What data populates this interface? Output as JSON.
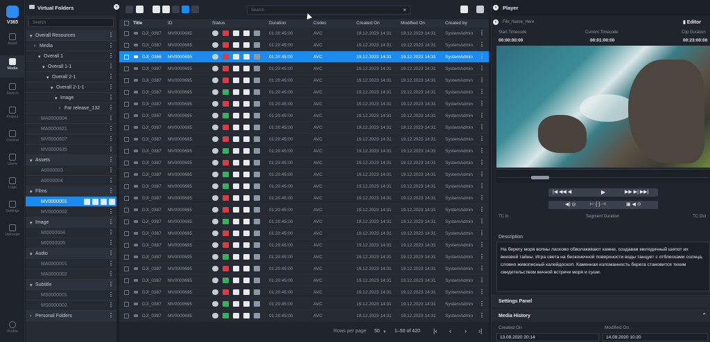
{
  "nav": {
    "brand": "V365",
    "items": [
      {
        "label": "Asset",
        "icon": "asset-icon"
      },
      {
        "label": "Media",
        "icon": "media-icon"
      },
      {
        "label": "Search",
        "icon": "search-icon"
      },
      {
        "label": "Project",
        "icon": "project-icon"
      },
      {
        "label": "Control",
        "icon": "control-icon"
      },
      {
        "label": "Users",
        "icon": "users-icon"
      },
      {
        "label": "Logs",
        "icon": "logs-icon"
      },
      {
        "label": "Settings",
        "icon": "gear-icon"
      },
      {
        "label": "Uploader",
        "icon": "upload-icon"
      },
      {
        "label": "Profile",
        "icon": "profile-icon"
      }
    ]
  },
  "folders": {
    "title": "Virtual Folders",
    "search_placeholder": "Search",
    "tree": [
      {
        "label": "Overall Resources",
        "type": "sec"
      },
      {
        "label": "Media",
        "type": "node"
      },
      {
        "label": "Overall 1",
        "type": "node"
      },
      {
        "label": "Overall 1-1",
        "type": "node"
      },
      {
        "label": "Overall 2-1",
        "type": "node"
      },
      {
        "label": "Overall 2-1-1",
        "type": "node"
      },
      {
        "label": "Image",
        "type": "node"
      },
      {
        "label": "For release_132",
        "type": "node"
      },
      {
        "label": "MA0000604",
        "type": "dim"
      },
      {
        "label": "MA0000621",
        "type": "dim"
      },
      {
        "label": "MV0000607",
        "type": "dim"
      },
      {
        "label": "MV0000635",
        "type": "dim"
      },
      {
        "label": "Assets",
        "type": "sec"
      },
      {
        "label": "A0000003",
        "type": "dim"
      },
      {
        "label": "A0000004",
        "type": "dim"
      },
      {
        "label": "Films",
        "type": "sec"
      },
      {
        "label": "MV0000001",
        "type": "sel"
      },
      {
        "label": "MV0000002",
        "type": "dim"
      },
      {
        "label": "Image",
        "type": "sec"
      },
      {
        "label": "MI0000004",
        "type": "dim"
      },
      {
        "label": "MI0000005",
        "type": "dim"
      },
      {
        "label": "Audio",
        "type": "sec"
      },
      {
        "label": "MA0000001",
        "type": "dim"
      },
      {
        "label": "MA0000002",
        "type": "dim"
      },
      {
        "label": "Subtitle",
        "type": "sec"
      },
      {
        "label": "MS0000001",
        "type": "dim"
      },
      {
        "label": "MS0000002",
        "type": "dim"
      },
      {
        "label": "Personal Folders",
        "type": "sec"
      }
    ]
  },
  "list": {
    "search_placeholder": "Search",
    "columns": [
      "Title",
      "ID",
      "Status",
      "Duration",
      "Codec",
      "Created On",
      "Modified On",
      "Created by"
    ],
    "rows": [
      {
        "title": "DJI_0387",
        "id": "MV0000695",
        "duration": "01:20:45:00",
        "codec": "AVC",
        "created": "19.12.2023 14:31",
        "modified": "19.12.2023 14:31",
        "by": "SystemAdmin",
        "status": "r"
      },
      {
        "title": "DJI_0387",
        "id": "MV0000695",
        "duration": "01:20:45:00",
        "codec": "AVC",
        "created": "19.12.2023 14:31",
        "modified": "19.12.2023 14:31",
        "by": "SystemAdmin",
        "status": "r"
      },
      {
        "title": "DJI_0386",
        "id": "MV0000695",
        "duration": "01:20:45:00",
        "codec": "AVC",
        "created": "19.12.2023 14:31",
        "modified": "19.12.2023 14:31",
        "by": "SystemAdmin",
        "status": "r",
        "selected": true
      },
      {
        "title": "DJI_0387",
        "id": "MV0000695",
        "duration": "01:20:45:00",
        "codec": "AVC",
        "created": "19.12.2023 14:31",
        "modified": "19.12.2023 14:31",
        "by": "SystemAdmin",
        "status": "r"
      },
      {
        "title": "DJI_0387",
        "id": "MV0000695",
        "duration": "01:20:45:00",
        "codec": "AVC",
        "created": "19.12.2023 14:31",
        "modified": "19.12.2023 14:31",
        "by": "SystemAdmin",
        "status": "r"
      },
      {
        "title": "DJI_0387",
        "id": "MV0000695",
        "duration": "01:20:45:00",
        "codec": "AVC",
        "created": "19.12.2023 14:31",
        "modified": "19.12.2023 14:31",
        "by": "SystemAdmin",
        "status": "g"
      },
      {
        "title": "DJI_0387",
        "id": "MV0000695",
        "duration": "01:20:45:00",
        "codec": "AVC",
        "created": "19.12.2023 14:31",
        "modified": "19.12.2023 14:31",
        "by": "SystemAdmin",
        "status": "r"
      },
      {
        "title": "DJI_0387",
        "id": "MV0000695",
        "duration": "01:20:45:00",
        "codec": "AVC",
        "created": "19.12.2023 14:31",
        "modified": "19.12.2023 14:31",
        "by": "SystemAdmin",
        "status": "g"
      },
      {
        "title": "DJI_0387",
        "id": "MV0000695",
        "duration": "01:20:45:00",
        "codec": "AVC",
        "created": "19.12.2023 14:31",
        "modified": "19.12.2023 14:31",
        "by": "SystemAdmin",
        "status": "r"
      },
      {
        "title": "DJI_0387",
        "id": "MV0000695",
        "duration": "01:20:45:00",
        "codec": "AVC",
        "created": "19.12.2023 14:31",
        "modified": "19.12.2023 14:31",
        "by": "SystemAdmin",
        "status": "r"
      },
      {
        "title": "DJI_0387",
        "id": "MV0000695",
        "duration": "01:20:45:00",
        "codec": "AVC",
        "created": "19.12.2023 14:31",
        "modified": "19.12.2023 14:31",
        "by": "SystemAdmin",
        "status": "g"
      },
      {
        "title": "DJI_0387",
        "id": "MV0000695",
        "duration": "01:20:45:00",
        "codec": "AVC",
        "created": "19.12.2023 14:31",
        "modified": "19.12.2023 14:31",
        "by": "SystemAdmin",
        "status": "r"
      },
      {
        "title": "DJI_0387",
        "id": "MV0000695",
        "duration": "01:20:45:00",
        "codec": "AVC",
        "created": "19.12.2023 14:31",
        "modified": "19.12.2023 14:31",
        "by": "SystemAdmin",
        "status": "g"
      },
      {
        "title": "DJI_0387",
        "id": "MV0000695",
        "duration": "01:20:45:00",
        "codec": "AVC",
        "created": "19.12.2023 14:31",
        "modified": "19.12.2023 14:31",
        "by": "SystemAdmin",
        "status": "g"
      },
      {
        "title": "DJI_0387",
        "id": "MV0000695",
        "duration": "01:20:45:00",
        "codec": "AVC",
        "created": "19.12.2023 14:31",
        "modified": "19.12.2023 14:31",
        "by": "SystemAdmin",
        "status": "r"
      },
      {
        "title": "DJI_0387",
        "id": "MV0000695",
        "duration": "01:20:45:00",
        "codec": "AVC",
        "created": "19.12.2023 14:31",
        "modified": "19.12.2023 14:31",
        "by": "SystemAdmin",
        "status": "r"
      },
      {
        "title": "DJI_0387",
        "id": "MV0000695",
        "duration": "01:20:45:00",
        "codec": "AVC",
        "created": "19.12.2023 14:31",
        "modified": "19.12.2023 14:31",
        "by": "SystemAdmin",
        "status": "g"
      },
      {
        "title": "DJI_0387",
        "id": "MV0000695",
        "duration": "01:20:45:00",
        "codec": "AVC",
        "created": "19.12.2023 14:31",
        "modified": "19.12.2023 14:31",
        "by": "SystemAdmin",
        "status": "r"
      },
      {
        "title": "DJI_0387",
        "id": "MV0000695",
        "duration": "01:20:45:00",
        "codec": "AVC",
        "created": "19.12.2023 14:31",
        "modified": "19.12.2023 14:31",
        "by": "SystemAdmin",
        "status": "r"
      },
      {
        "title": "DJI_0387",
        "id": "MV0000695",
        "duration": "01:20:45:00",
        "codec": "AVC",
        "created": "19.12.2023 14:31",
        "modified": "19.12.2023 14:31",
        "by": "SystemAdmin",
        "status": "g"
      },
      {
        "title": "DJI_0387",
        "id": "MV0000695",
        "duration": "01:20:45:00",
        "codec": "AVC",
        "created": "19.12.2023 14:31",
        "modified": "19.12.2023 14:31",
        "by": "SystemAdmin",
        "status": "r"
      },
      {
        "title": "DJI_0387",
        "id": "MV0000695",
        "duration": "01:20:45:00",
        "codec": "AVC",
        "created": "19.12.2023 14:31",
        "modified": "19.12.2023 14:31",
        "by": "SystemAdmin",
        "status": "g"
      },
      {
        "title": "DJI_0387",
        "id": "MV0000695",
        "duration": "01:20:45:00",
        "codec": "AVC",
        "created": "19.12.2023 14:31",
        "modified": "19.12.2023 14:31",
        "by": "SystemAdmin",
        "status": "r"
      },
      {
        "title": "DJI_0387",
        "id": "MV0000695",
        "duration": "01:20:45:00",
        "codec": "AVC",
        "created": "19.12.2023 14:31",
        "modified": "19.12.2023 14:31",
        "by": "SystemAdmin",
        "status": "g"
      },
      {
        "title": "DJI_0387",
        "id": "MV0000695",
        "duration": "01:20:45:00",
        "codec": "AVC",
        "created": "19.12.2023 14:31",
        "modified": "19.12.2023 14:31",
        "by": "SystemAdmin",
        "status": "g"
      }
    ],
    "footer": {
      "rows_per_page_label": "Rows per page",
      "rows_per_page": "50",
      "range": "1–50 of 420"
    }
  },
  "player": {
    "title": "Player",
    "file_name": "File_Name_Here",
    "editor_label": "Editor",
    "timecodes": [
      {
        "label": "Start Timecode",
        "value": "00:00:00:00"
      },
      {
        "label": "Current Timecode",
        "value": "00:01:00:00"
      },
      {
        "label": "Clip Duration",
        "value": "00:23:00:00"
      }
    ],
    "tc_in": "TC In",
    "segment_duration": "Segment Duration",
    "tc_out": "TC Out",
    "description_label": "Description",
    "description": "На берегу моря волны ласково обволакивают камни, создавая мелодичный шепот их вековой тайны. Игра света на бесконечной поверхности воды танцует с отблесками солнца, словно живописный калейдоскоп. Каменная изломанность берега становится тихим свидетельством вечной встречи моря и суши.",
    "settings_panel": "Settings Panel",
    "media_history": "Media History",
    "created_on_label": "Created On",
    "created_on": "13.09.2020 20:14",
    "modified_on_label": "Modified On",
    "modified_on": "14.09.2020 10:20"
  },
  "colors": {
    "accent": "#1c8bf0",
    "status_red": "#e0393e",
    "status_green": "#35b35c"
  }
}
